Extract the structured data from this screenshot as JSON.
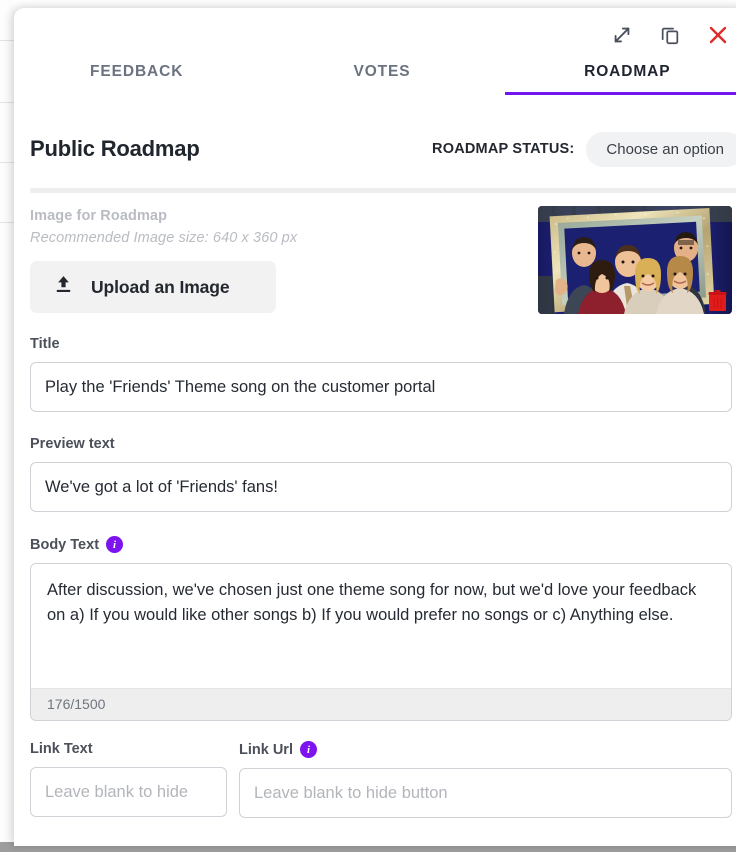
{
  "window": {
    "controls": [
      {
        "name": "expand-icon",
        "label": "Expand"
      },
      {
        "name": "duplicate-icon",
        "label": "Duplicate"
      },
      {
        "name": "close-icon",
        "label": "Close"
      }
    ]
  },
  "tabs": [
    {
      "label": "FEEDBACK",
      "active": false
    },
    {
      "label": "VOTES",
      "active": false
    },
    {
      "label": "ROADMAP",
      "active": true
    }
  ],
  "header": {
    "title": "Public Roadmap",
    "status_label": "ROADMAP STATUS:",
    "status_value": "Choose an option"
  },
  "image_section": {
    "label": "Image for Roadmap",
    "recommendation": "Recommended Image size: 640 x 360 px",
    "upload_button": "Upload an Image",
    "thumbnail_alt": "Friends cast photo in gold picture frame",
    "delete_icon": "trash-icon"
  },
  "fields": {
    "title": {
      "label": "Title",
      "value": "Play the 'Friends' Theme song on the customer portal",
      "placeholder": ""
    },
    "preview": {
      "label": "Preview text",
      "value": "We've got a lot of 'Friends' fans!",
      "placeholder": ""
    },
    "body": {
      "label": "Body Text",
      "info_icon": "info-icon",
      "value": "After discussion, we've chosen just one theme song for now, but we'd love your feedback on a) If you would like other songs b) If you would prefer no songs or c) Anything else.",
      "placeholder": "",
      "char_count": "176/1500"
    },
    "link_text": {
      "label": "Link Text",
      "value": "",
      "placeholder": "Leave blank to hide"
    },
    "link_url": {
      "label": "Link Url",
      "info_icon": "info-icon",
      "value": "",
      "placeholder": "Leave blank to hide button"
    }
  },
  "colors": {
    "accent": "#7415f0",
    "close": "#e02b2b",
    "info": "#7d14ef",
    "pill_bg": "#f1f2f3"
  }
}
